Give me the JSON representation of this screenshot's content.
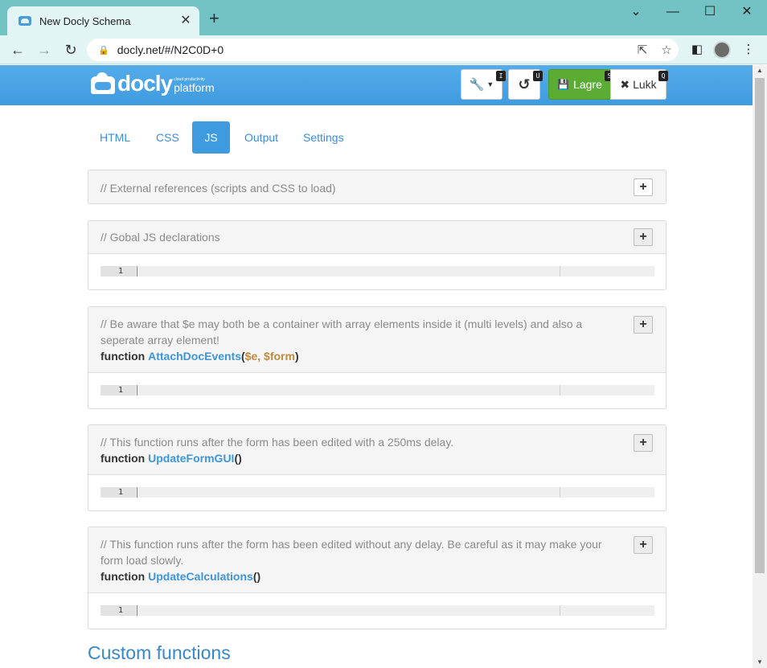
{
  "browser": {
    "tab_title": "New Docly Schema",
    "tab_close_glyph": "✕",
    "new_tab_glyph": "+",
    "url": "docly.net/#/N2C0D+0",
    "window_controls": [
      "⌄",
      "—",
      "☐",
      "✕"
    ]
  },
  "app": {
    "logo_word": "docly",
    "logo_tagline": "cloud productivity",
    "logo_platform": "platform",
    "toolbar": {
      "tools_shortcut": "I",
      "undo_shortcut": "U",
      "save_label": "Lagre",
      "save_shortcut": "S",
      "close_label": "Lukk",
      "close_shortcut": "Q"
    },
    "tabs": [
      {
        "label": "HTML",
        "active": false
      },
      {
        "label": "CSS",
        "active": false
      },
      {
        "label": "JS",
        "active": true
      },
      {
        "label": "Output",
        "active": false
      },
      {
        "label": "Settings",
        "active": false
      }
    ],
    "panels": [
      {
        "comment": "// External references (scripts and CSS to load)"
      },
      {
        "comment": "// Gobal JS declarations",
        "line_number": "1"
      },
      {
        "comment": "// Be aware that $e may both be a container with array elements inside it (multi levels) and also a seperate array element!",
        "keyword": "function",
        "name": "AttachDocEvents",
        "open_paren": "(",
        "params": "$e, $form",
        "close_paren": ")",
        "line_number": "1"
      },
      {
        "comment": "// This function runs after the form has been edited with a 250ms delay.",
        "keyword": "function",
        "name": "UpdateFormGUI",
        "parens": "()",
        "line_number": "1"
      },
      {
        "comment": "// This function runs after the form has been edited without any delay. Be careful as it may make your form load slowly.",
        "keyword": "function",
        "name": "UpdateCalculations",
        "parens": "()",
        "line_number": "1"
      }
    ],
    "section_title": "Custom functions",
    "plus_glyph": "+"
  },
  "colors": {
    "chrome_titlebar": "#73c2c4",
    "chrome_toolbar": "#e3f4f4",
    "app_header": "#4da7e6",
    "active_tab": "#3f9be0",
    "save_button": "#5cab33",
    "function_name": "#3e95d8",
    "params": "#c08a3e"
  }
}
